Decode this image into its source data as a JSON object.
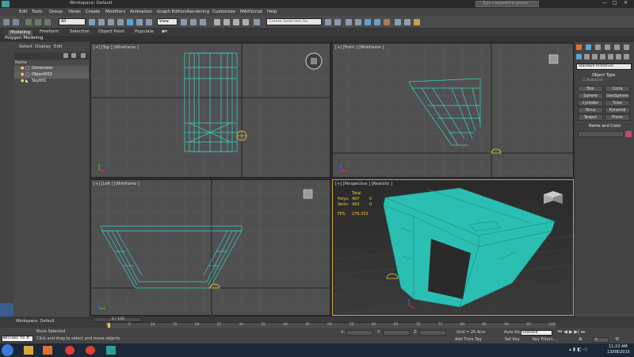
{
  "titlebar": {
    "workspace": "Workspace: Default",
    "search_placeholder": "Type a keyword or phrase"
  },
  "menu": [
    "Edit",
    "Tools",
    "Group",
    "Views",
    "Create",
    "Modifiers",
    "Animation",
    "Graph Editors",
    "Rendering",
    "Customize",
    "MAXScript",
    "Help"
  ],
  "toolbar": {
    "selection_filter": "All",
    "view_dropdown": "View",
    "named_selection": "Create Selection Se"
  },
  "ribbon": {
    "tabs": [
      "Modeling",
      "Freeform",
      "Selection",
      "Object Paint",
      "Populate"
    ],
    "subtab": "Polygon Modeling"
  },
  "scene_explorer": {
    "menu": [
      "Select",
      "Display",
      "Edit"
    ],
    "column_header": "Name",
    "items": [
      "Dimension",
      "Object002",
      "Sky001"
    ]
  },
  "viewports": {
    "top": "[+] [Top ] [Wireframe ]",
    "front": "[+] [Front ] [Wireframe ]",
    "left": "[+] [Left ] [Wireframe ]",
    "perspective": "[+] [Perspective ] [Realistic ]",
    "stats": {
      "total_label": "Total",
      "polys_label": "Polys:",
      "polys_value": "497",
      "polys_sel": "0",
      "verts_label": "Verts:",
      "verts_value": "493",
      "verts_sel": "0",
      "fps_label": "FPS:",
      "fps_value": "276.333"
    }
  },
  "command_panel": {
    "category": "Standard Primitives",
    "rollout_object_type": "Object Type",
    "autogrid": "AutoGrid",
    "buttons": [
      "Box",
      "Cone",
      "Sphere",
      "GeoSphere",
      "Cylinder",
      "Tube",
      "Torus",
      "Pyramid",
      "Teapot",
      "Plane"
    ],
    "rollout_name_color": "Name and Color"
  },
  "timeline": {
    "frame_readout": "0 / 100",
    "ticks": [
      "0",
      "5",
      "10",
      "15",
      "20",
      "25",
      "30",
      "35",
      "40",
      "45",
      "50",
      "55",
      "60",
      "65",
      "70",
      "75",
      "80",
      "85",
      "90",
      "95",
      "100"
    ]
  },
  "status": {
    "workspace": "Workspace: Default",
    "selected": "None Selected",
    "prompt": "Click and drag to select and move objects",
    "welcome": "Welcome to M",
    "x_label": "X:",
    "y_label": "Y:",
    "z_label": "Z:",
    "grid": "Grid = 25.4cm",
    "add_time_tag": "Add Time Tag",
    "auto_key": "Auto Key",
    "set_key": "Set Key",
    "selected_dropdown": "Selected",
    "key_filters": "Key Filters...",
    "frame": "0"
  },
  "taskbar": {
    "time": "11:22 AM",
    "date": "13/08/2015"
  },
  "colors": {
    "accent": "#4aa3c8",
    "mesh": "#2bbfb3",
    "wire": "#38d6c4",
    "viewport_bg": "#505050",
    "active_border": "#c8a23a"
  }
}
